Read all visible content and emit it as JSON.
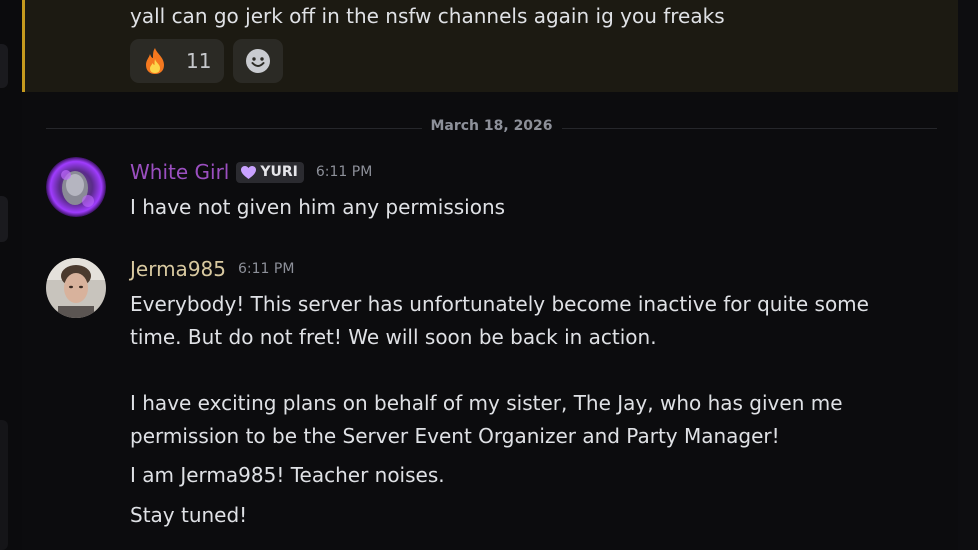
{
  "highlighted_message": {
    "text": "yall can go jerk off in the nsfw channels again ig you freaks",
    "reactions": [
      {
        "emoji": "fire-emoji",
        "count": "11"
      },
      {
        "icon": "add-reaction-smile-icon"
      }
    ]
  },
  "date_divider": "March 18, 2026",
  "messages": [
    {
      "username": "White Girl",
      "username_color": "#9b4fc0",
      "badge": "YURI",
      "timestamp": "6:11 PM",
      "lines": [
        "I have not given him any permissions"
      ]
    },
    {
      "username": "Jerma985",
      "username_color": "#d8c9a0",
      "timestamp": "6:11 PM",
      "lines": [
        "Everybody! This server has unfortunately become inactive for quite some",
        "time. But do not fret! We will soon be back in action.",
        "I have exciting plans on behalf of my sister, The Jay, who has given me",
        "permission to be the Server Event Organizer and Party Manager!",
        "I am Jerma985! Teacher noises.",
        "Stay tuned!"
      ]
    }
  ]
}
